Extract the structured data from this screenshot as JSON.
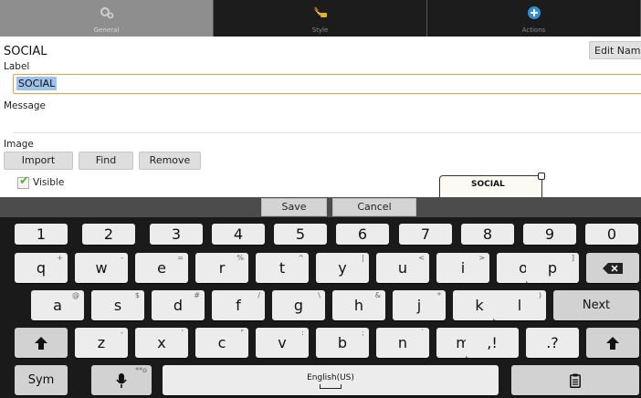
{
  "tabs": [
    {
      "label": "General",
      "icon": "gears-icon",
      "active": true
    },
    {
      "label": "Style",
      "icon": "paint-brush-icon",
      "active": false
    },
    {
      "label": "Actions",
      "icon": "plus-circle-icon",
      "active": false
    }
  ],
  "form": {
    "title": "SOCIAL",
    "edit_name_label": "Edit Name",
    "label_caption": "Label",
    "label_value": "SOCIAL",
    "message_caption": "Message",
    "message_value": "",
    "image_caption": "Image",
    "image_buttons": [
      "Import",
      "Find",
      "Remove"
    ],
    "visible_label": "Visible",
    "visible_checked": true,
    "preview_text": "SOCIAL"
  },
  "action_bar": {
    "save_label": "Save",
    "cancel_label": "Cancel"
  },
  "keyboard": {
    "row_numbers": [
      "1",
      "2",
      "3",
      "4",
      "5",
      "6",
      "7",
      "8",
      "9",
      "0"
    ],
    "row1": [
      {
        "key": "q",
        "alt": "+"
      },
      {
        "key": "w",
        "alt": "-"
      },
      {
        "key": "e",
        "alt": "="
      },
      {
        "key": "r",
        "alt": "%"
      },
      {
        "key": "t",
        "alt": "^"
      },
      {
        "key": "y",
        "alt": "|"
      },
      {
        "key": "u",
        "alt": "<"
      },
      {
        "key": "i",
        "alt": ">"
      },
      {
        "key": "o",
        "alt": "["
      },
      {
        "key": "p",
        "alt": "]"
      }
    ],
    "row2": [
      {
        "key": "a",
        "alt": "@"
      },
      {
        "key": "s",
        "alt": "$"
      },
      {
        "key": "d",
        "alt": "#"
      },
      {
        "key": "f",
        "alt": "/"
      },
      {
        "key": "g",
        "alt": "\\"
      },
      {
        "key": "h",
        "alt": "&"
      },
      {
        "key": "j",
        "alt": "*"
      },
      {
        "key": "k",
        "alt": "("
      },
      {
        "key": "l",
        "alt": ")"
      }
    ],
    "row3": [
      {
        "key": "z",
        "alt": "-"
      },
      {
        "key": "x",
        "alt": "'"
      },
      {
        "key": "c",
        "alt": "\""
      },
      {
        "key": "v",
        "alt": ":"
      },
      {
        "key": "b",
        "alt": ";"
      },
      {
        "key": "n",
        "alt": "`"
      },
      {
        "key": "m",
        "alt": "~"
      },
      {
        "key": ",!",
        "alt": ""
      },
      {
        "key": ".?",
        "alt": ""
      }
    ],
    "next_label": "Next",
    "sym_label": "Sym",
    "space_label": "English(US)",
    "mic_sup": "**o"
  },
  "colors": {
    "accent_orange": "#e9a040",
    "selection_blue": "#9ec3ea",
    "check_green": "#5bb031"
  }
}
